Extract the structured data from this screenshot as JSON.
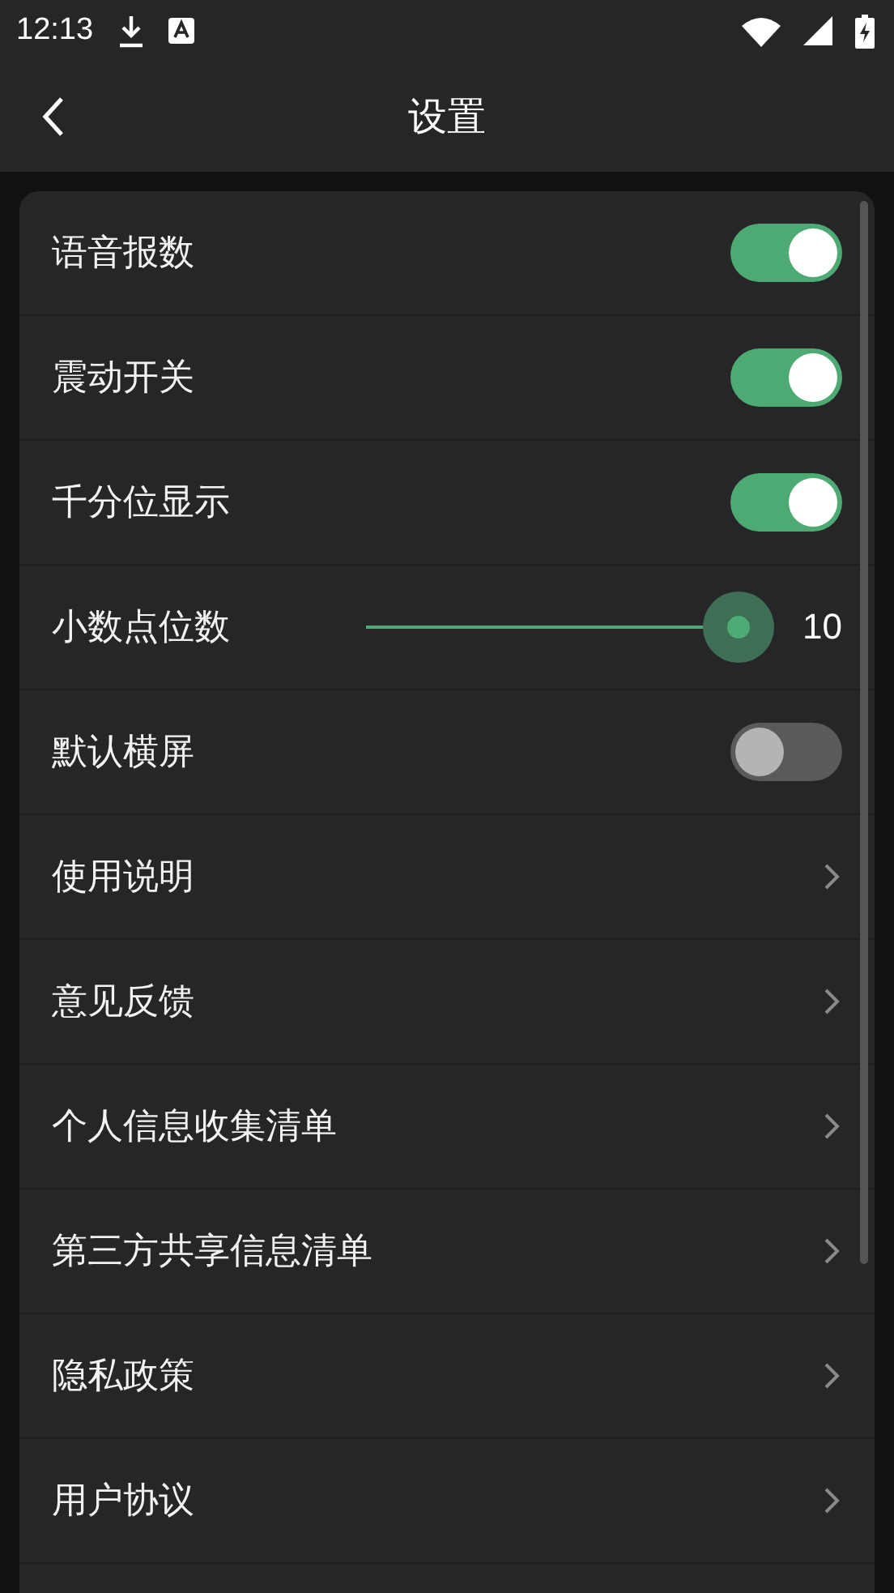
{
  "status_bar": {
    "time": "12:13"
  },
  "app_bar": {
    "title": "设置"
  },
  "settings": [
    {
      "kind": "toggle",
      "label": "语音报数",
      "on": true
    },
    {
      "kind": "toggle",
      "label": "震动开关",
      "on": true
    },
    {
      "kind": "toggle",
      "label": "千分位显示",
      "on": true
    },
    {
      "kind": "slider",
      "label": "小数点位数",
      "level": 1,
      "reading": "10"
    },
    {
      "kind": "toggle",
      "label": "默认横屏",
      "on": false
    },
    {
      "kind": "link",
      "label": "使用说明"
    },
    {
      "kind": "link",
      "label": "意见反馈"
    },
    {
      "kind": "link",
      "label": "个人信息收集清单"
    },
    {
      "kind": "link",
      "label": "第三方共享信息清单"
    },
    {
      "kind": "link",
      "label": "隐私政策"
    },
    {
      "kind": "link",
      "label": "用户协议"
    }
  ]
}
